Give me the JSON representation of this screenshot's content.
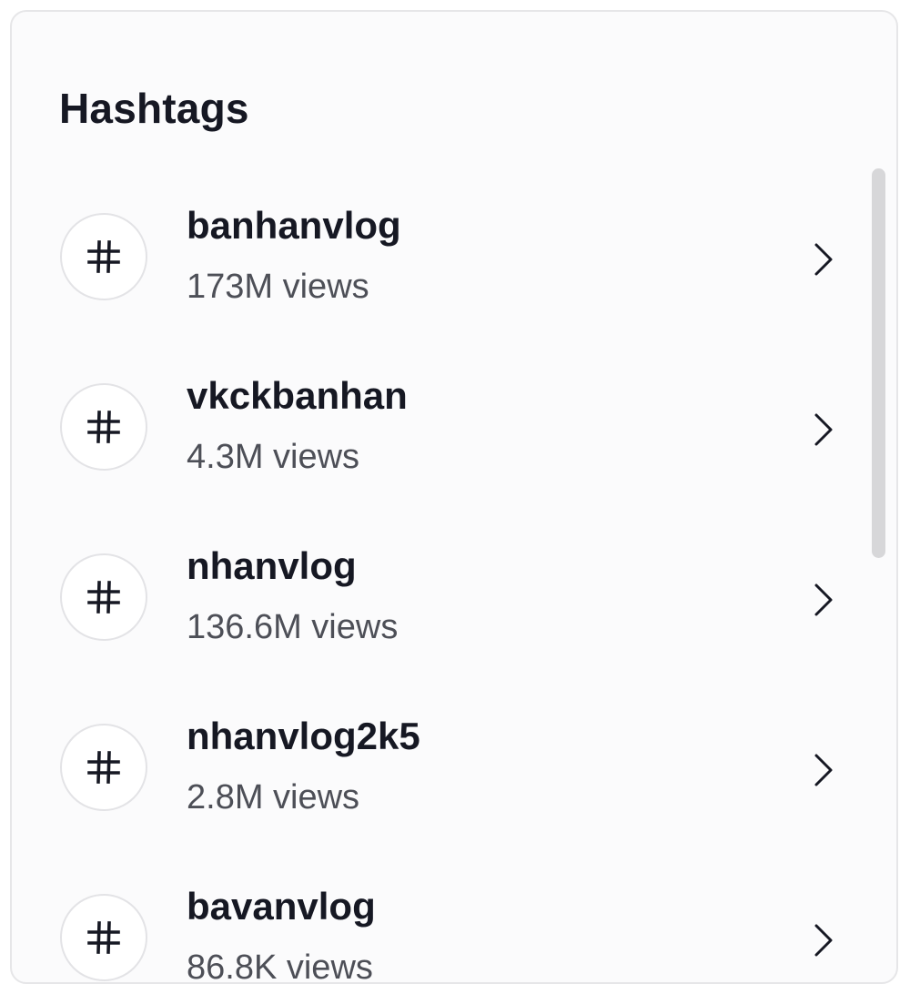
{
  "panel": {
    "title": "Hashtags"
  },
  "hashtags": [
    {
      "name": "banhanvlog",
      "views": "173M views",
      "icon": "hashtag-icon",
      "action_icon": "chevron-right-icon"
    },
    {
      "name": "vkckbanhan",
      "views": "4.3M views",
      "icon": "hashtag-icon",
      "action_icon": "chevron-right-icon"
    },
    {
      "name": "nhanvlog",
      "views": "136.6M views",
      "icon": "hashtag-icon",
      "action_icon": "chevron-right-icon"
    },
    {
      "name": "nhanvlog2k5",
      "views": "2.8M views",
      "icon": "hashtag-icon",
      "action_icon": "chevron-right-icon"
    },
    {
      "name": "bavanvlog",
      "views": "86.8K views",
      "icon": "hashtag-icon",
      "action_icon": "chevron-right-icon"
    }
  ],
  "colors": {
    "text_primary": "#161823",
    "text_secondary": "#4d4f57",
    "border": "#e6e6e8",
    "scrollbar": "#d7d7d9"
  }
}
